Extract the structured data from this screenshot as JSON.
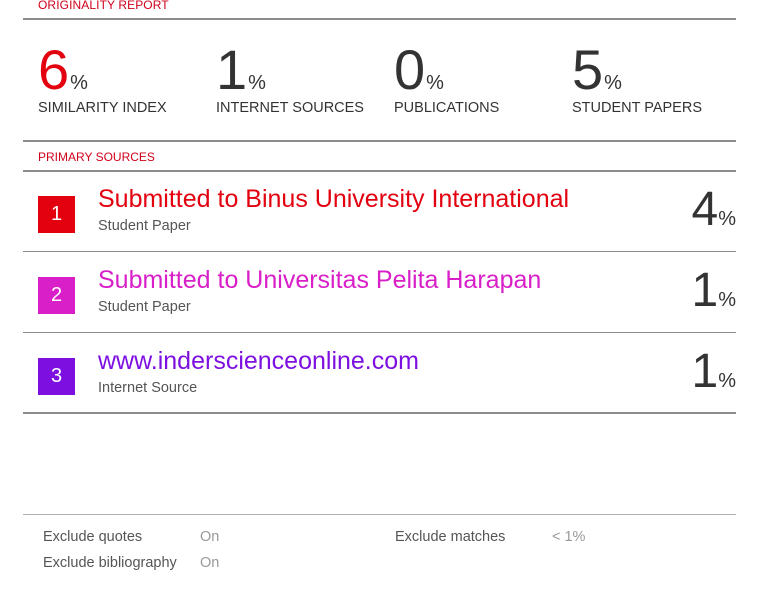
{
  "header": {
    "title": "ORIGINALITY REPORT"
  },
  "stats": [
    {
      "value": "6",
      "unit": "%",
      "label": "SIMILARITY INDEX"
    },
    {
      "value": "1",
      "unit": "%",
      "label": "INTERNET SOURCES"
    },
    {
      "value": "0",
      "unit": "%",
      "label": "PUBLICATIONS"
    },
    {
      "value": "5",
      "unit": "%",
      "label": "STUDENT PAPERS"
    }
  ],
  "primary_sources": {
    "title": "PRIMARY SOURCES",
    "items": [
      {
        "rank": "1",
        "name": "Submitted to Binus University International",
        "type": "Student Paper",
        "share": "4",
        "unit": "%",
        "color": "#e3000f"
      },
      {
        "rank": "2",
        "name": "Submitted to Universitas Pelita Harapan",
        "type": "Student Paper",
        "share": "1",
        "unit": "%",
        "color": "#d81fc8"
      },
      {
        "rank": "3",
        "name": "www.inderscienceonline.com",
        "type": "Internet Source",
        "share": "1",
        "unit": "%",
        "color": "#7d10e0"
      }
    ]
  },
  "options": {
    "exclude_quotes": {
      "label": "Exclude quotes",
      "value": "On"
    },
    "exclude_bibliography": {
      "label": "Exclude bibliography",
      "value": "On"
    },
    "exclude_matches": {
      "label": "Exclude matches",
      "value": "< 1%"
    }
  },
  "colors": {
    "accent": "#d0021b",
    "similarity": "#e3000f"
  }
}
